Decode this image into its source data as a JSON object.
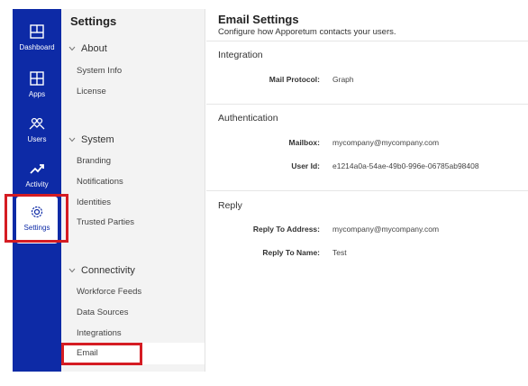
{
  "rail": {
    "items": [
      {
        "label": "Dashboard",
        "icon": "dashboard-icon"
      },
      {
        "label": "Apps",
        "icon": "apps-icon"
      },
      {
        "label": "Users",
        "icon": "users-icon"
      },
      {
        "label": "Activity",
        "icon": "activity-icon"
      },
      {
        "label": "Settings",
        "icon": "gear-icon"
      }
    ],
    "active": "Settings"
  },
  "nav": {
    "title": "Settings",
    "sections": [
      {
        "label": "About",
        "items": [
          "System Info",
          "License"
        ]
      },
      {
        "label": "System",
        "items": [
          "Branding",
          "Notifications",
          "Identities",
          "Trusted Parties"
        ]
      },
      {
        "label": "Connectivity",
        "items": [
          "Workforce Feeds",
          "Data Sources",
          "Integrations",
          "Email"
        ]
      }
    ],
    "selected": "Email"
  },
  "main": {
    "title": "Email Settings",
    "subtitle": "Configure how Apporetum contacts your users.",
    "sections": [
      {
        "label": "Integration",
        "fields": [
          {
            "label": "Mail Protocol:",
            "value": "Graph"
          }
        ]
      },
      {
        "label": "Authentication",
        "fields": [
          {
            "label": "Mailbox:",
            "value": "mycompany@mycompany.com"
          },
          {
            "label": "User Id:",
            "value": "e1214a0a-54ae-49b0-996e-06785ab98408"
          }
        ]
      },
      {
        "label": "Reply",
        "fields": [
          {
            "label": "Reply To Address:",
            "value": "mycompany@mycompany.com"
          },
          {
            "label": "Reply To Name:",
            "value": "Test"
          }
        ]
      }
    ]
  },
  "colors": {
    "rail": "#0d2aa6",
    "highlight": "#d51c23",
    "nav_bg": "#f3f3f3"
  }
}
